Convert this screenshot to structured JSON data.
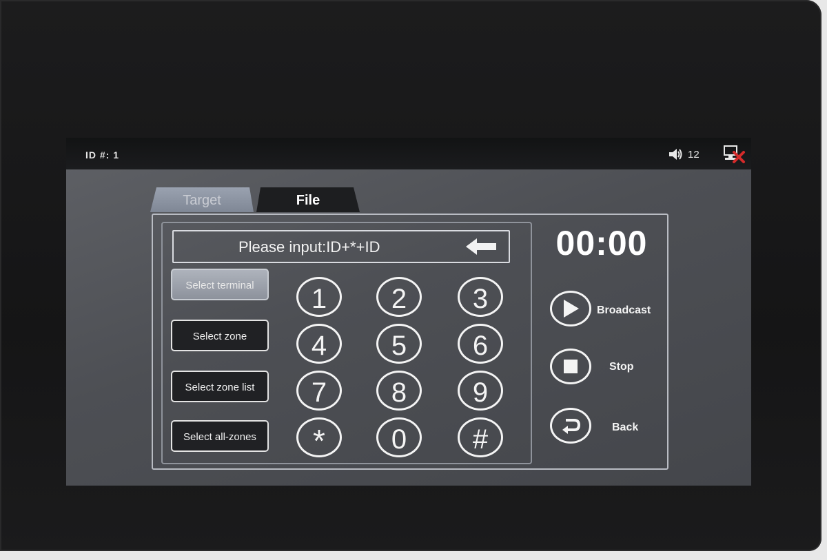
{
  "status": {
    "id_label": "ID #: 1",
    "volume_value": "12",
    "icons": [
      "speaker-icon",
      "network-disconnected-icon"
    ]
  },
  "tabs": [
    {
      "label": "Target",
      "active": true
    },
    {
      "label": "File",
      "active": false
    }
  ],
  "input": {
    "prompt": "Please input:ID+*+ID",
    "backspace_icon": "backspace-arrow-icon"
  },
  "side_buttons": [
    {
      "label": "Select terminal",
      "active": true
    },
    {
      "label": "Select zone",
      "active": false
    },
    {
      "label": "Select zone list",
      "active": false
    },
    {
      "label": "Select all-zones",
      "active": false
    }
  ],
  "keypad": [
    "1",
    "2",
    "3",
    "4",
    "5",
    "6",
    "7",
    "8",
    "9",
    "*",
    "0",
    "#"
  ],
  "timer": "00:00",
  "controls": [
    {
      "label": "Broadcast",
      "icon": "play-icon"
    },
    {
      "label": "Stop",
      "icon": "stop-icon"
    },
    {
      "label": "Back",
      "icon": "back-icon"
    }
  ],
  "colors": {
    "accent_tab_active": "#8a92a0",
    "screen_bg": "#505257",
    "status_bar": "#161718",
    "alert_red": "#d42a2a"
  }
}
